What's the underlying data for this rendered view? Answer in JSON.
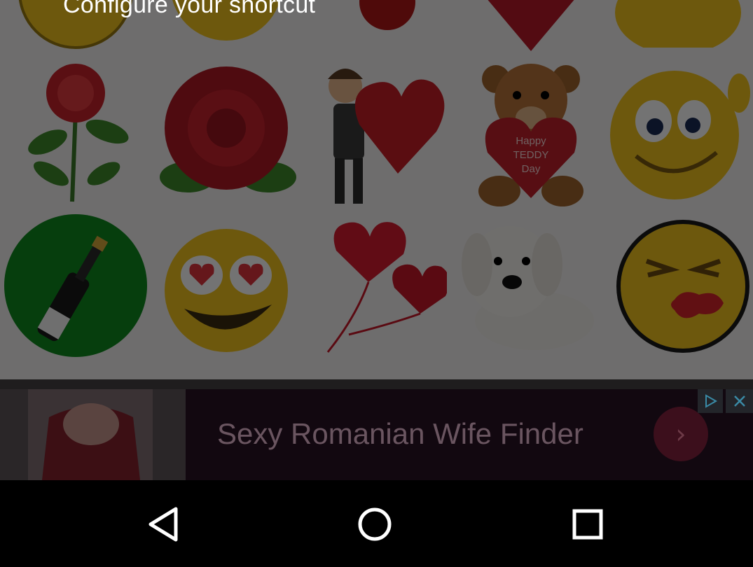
{
  "dialog": {
    "title": "Configure your shortcut"
  },
  "grid": {
    "items": [
      {
        "icon": "rose-icon"
      },
      {
        "icon": "red-rose-icon"
      },
      {
        "icon": "boy-with-heart-icon"
      },
      {
        "icon": "teddy-bear-heart-icon",
        "text": "Happy Teddy Day"
      },
      {
        "icon": "winking-smiley-icon"
      },
      {
        "icon": "champagne-icon"
      },
      {
        "icon": "heart-eyes-smiley-icon"
      },
      {
        "icon": "heart-balloons-icon"
      },
      {
        "icon": "puppy-icon"
      },
      {
        "icon": "kissing-smiley-icon"
      }
    ]
  },
  "ad": {
    "text": "Sexy Romanian Wife Finder",
    "arrow": "›",
    "adchoices_icon": "adchoices-icon",
    "close_icon": "close-icon"
  },
  "navigation": {
    "back": "back-icon",
    "home": "home-icon",
    "recents": "recents-icon"
  },
  "colors": {
    "overlay": "rgba(0,0,0,0.55)",
    "nav_bar": "#000000",
    "ad_background": "#120810"
  }
}
